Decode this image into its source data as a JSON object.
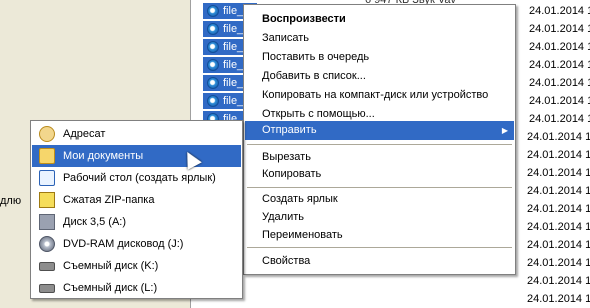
{
  "left_strip": {
    "partial_text": "длю"
  },
  "files": {
    "rows": [
      {
        "name": "file_1_(2012-10-14 10...",
        "date": "24.01.2014 1",
        "extra": "6 947 КБ    Звук Vav"
      },
      {
        "name": "file_2",
        "date": "24.01.2014 1"
      },
      {
        "name": "file_3",
        "date": "24.01.2014 1"
      },
      {
        "name": "file_4",
        "date": "24.01.2014 1"
      },
      {
        "name": "file_5",
        "date": "24.01.2014 1"
      },
      {
        "name": "file_6",
        "date": "24.01.2014 1"
      },
      {
        "name": "file_7",
        "date": "24.01.2014 1"
      }
    ],
    "extra_dates": [
      "24.01.2014 1",
      "24.01.2014 1",
      "24.01.2014 1",
      "24.01.2014 1",
      "24.01.2014 1",
      "24.01.2014 1",
      "24.01.2014 1",
      "24.01.2014 1",
      "24.01.2014 1",
      "24.01.2014 1",
      "24.01.2014 1"
    ]
  },
  "context_menu": {
    "items": {
      "play": "Воспроизвести",
      "record": "Записать",
      "queue": "Поставить в очередь",
      "add_to_list": "Добавить в список...",
      "copy_to_cd": "Копировать на компакт-диск или устройство",
      "open_with": "Открыть с помощью...",
      "send_to": "Отправить",
      "cut": "Вырезать",
      "copy": "Копировать",
      "shortcut": "Создать ярлык",
      "delete": "Удалить",
      "rename": "Переименовать",
      "properties": "Свойства"
    },
    "submenu_arrow": "▶"
  },
  "send_to_menu": {
    "items": [
      {
        "label": "Адресат",
        "icon": "contact-icon"
      },
      {
        "label": "Мои документы",
        "icon": "documents-folder-icon"
      },
      {
        "label": "Рабочий стол (создать ярлык)",
        "icon": "desktop-icon"
      },
      {
        "label": "Сжатая ZIP-папка",
        "icon": "zip-folder-icon"
      },
      {
        "label": "Диск 3,5 (A:)",
        "icon": "floppy-drive-icon"
      },
      {
        "label": "DVD-RAM дисковод (J:)",
        "icon": "dvd-drive-icon"
      },
      {
        "label": "Съемный диск (K:)",
        "icon": "removable-disk-icon"
      },
      {
        "label": "Съемный диск (L:)",
        "icon": "removable-disk-icon"
      }
    ]
  },
  "colors": {
    "selection": "#316ac5",
    "menu_border": "#808080",
    "separator": "#aca899"
  }
}
